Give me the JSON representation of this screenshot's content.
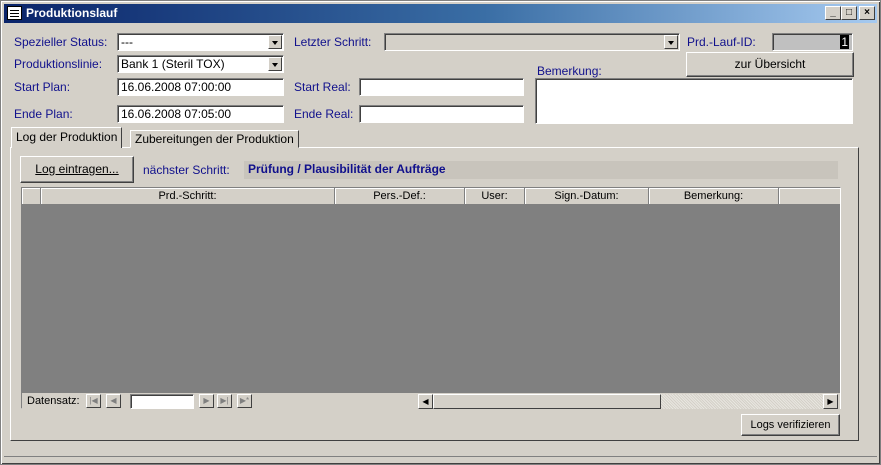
{
  "window": {
    "title": "Produktionslauf"
  },
  "fields": {
    "spezieller_status": {
      "label": "Spezieller Status:",
      "value": "---"
    },
    "produktionslinie": {
      "label": "Produktionslinie:",
      "value": "Bank 1 (Steril TOX)"
    },
    "start_plan": {
      "label": "Start Plan:",
      "value": "16.06.2008 07:00:00"
    },
    "ende_plan": {
      "label": "Ende Plan:",
      "value": "16.06.2008 07:05:00"
    },
    "letzter_schritt": {
      "label": "Letzter Schritt:",
      "value": ""
    },
    "start_real": {
      "label": "Start Real:",
      "value": ""
    },
    "ende_real": {
      "label": "Ende Real:",
      "value": ""
    },
    "prd_lauf_id": {
      "label": "Prd.-Lauf-ID:",
      "value": "1"
    },
    "bemerkung": {
      "label": "Bemerkung:",
      "value": ""
    }
  },
  "buttons": {
    "zur_uebersicht": "zur Übersicht",
    "log_eintragen": "Log eintragen...",
    "logs_verifizieren": "Logs verifizieren"
  },
  "tabs": [
    {
      "label": "Log der Produktion",
      "active": true
    },
    {
      "label": "Zubereitungen der Produktion",
      "active": false
    }
  ],
  "naechster_schritt": {
    "label": "nächster Schritt:",
    "value": "Prüfung / Plausibilität der Aufträge"
  },
  "grid": {
    "columns": [
      "Prd.-Schritt:",
      "Pers.-Def.:",
      "User:",
      "Sign.-Datum:",
      "Bemerkung:"
    ],
    "rows": []
  },
  "navigation": {
    "label": "Datensatz:",
    "record_value": ""
  },
  "colors": {
    "label_blue": "#10108c",
    "next_step_text": "#0a246a",
    "grid_background": "#808080"
  }
}
